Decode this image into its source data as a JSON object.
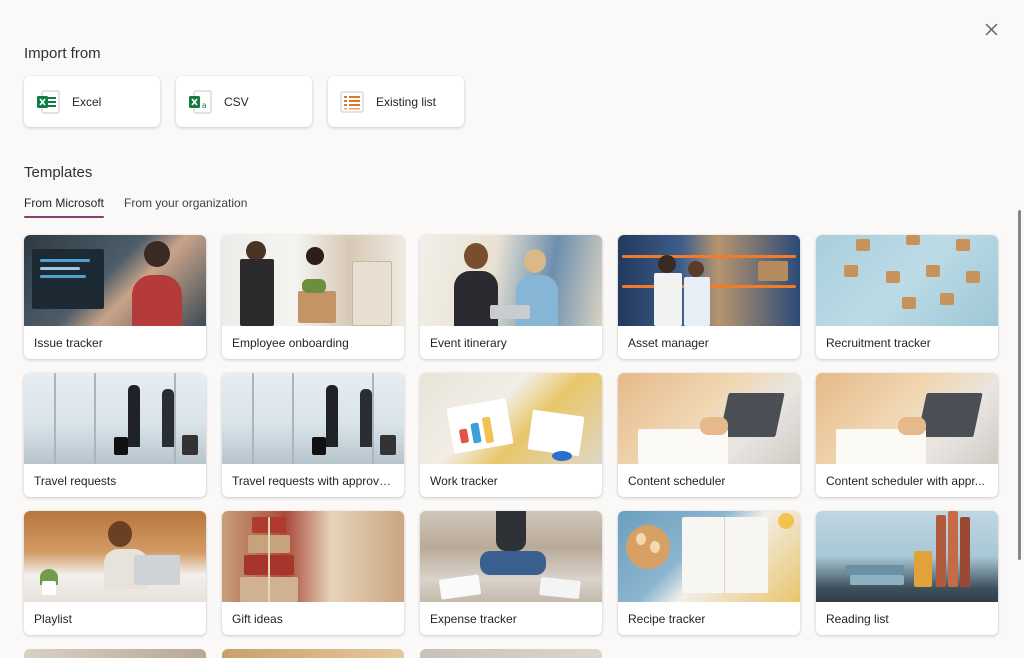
{
  "dialog": {
    "close_label": "Close"
  },
  "import": {
    "title": "Import from",
    "options": [
      {
        "label": "Excel",
        "icon": "excel-icon",
        "color": "#107c41"
      },
      {
        "label": "CSV",
        "icon": "csv-icon",
        "color": "#107c41"
      },
      {
        "label": "Existing list",
        "icon": "list-icon",
        "color": "#d97a2b"
      }
    ]
  },
  "templates": {
    "title": "Templates",
    "tabs": [
      {
        "label": "From Microsoft",
        "active": true
      },
      {
        "label": "From your organization",
        "active": false
      }
    ],
    "accent_color": "#8a3e6b",
    "items": [
      {
        "label": "Issue tracker",
        "thumb": "people-at-computer-image"
      },
      {
        "label": "Employee onboarding",
        "thumb": "handshake-office-image"
      },
      {
        "label": "Event itinerary",
        "thumb": "women-at-laptop-image"
      },
      {
        "label": "Asset manager",
        "thumb": "warehouse-shelves-image"
      },
      {
        "label": "Recruitment tracker",
        "thumb": "network-blocks-image"
      },
      {
        "label": "Travel requests",
        "thumb": "airport-travelers-image"
      },
      {
        "label": "Travel requests with approvals",
        "thumb": "airport-travelers-image"
      },
      {
        "label": "Work tracker",
        "thumb": "desk-charts-image"
      },
      {
        "label": "Content scheduler",
        "thumb": "hand-writing-laptop-image"
      },
      {
        "label": "Content scheduler with appr...",
        "thumb": "hand-writing-laptop-image"
      },
      {
        "label": "Playlist",
        "thumb": "woman-headphones-image"
      },
      {
        "label": "Gift ideas",
        "thumb": "stacked-gifts-image"
      },
      {
        "label": "Expense tracker",
        "thumb": "person-floor-receipts-image"
      },
      {
        "label": "Recipe tracker",
        "thumb": "eggs-notebook-image"
      },
      {
        "label": "Reading list",
        "thumb": "books-shelf-image"
      }
    ]
  }
}
